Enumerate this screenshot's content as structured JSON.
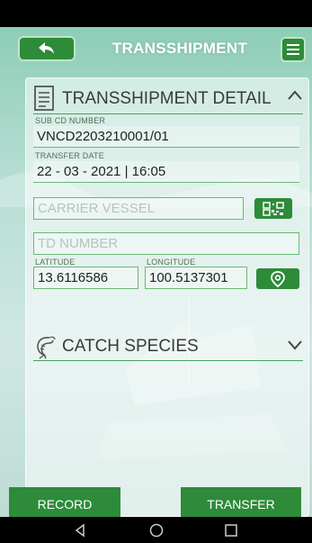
{
  "header": {
    "title": "TRANSSHIPMENT"
  },
  "details": {
    "section_title": "TRANSSHIPMENT DETAIL",
    "sub_cd_label": "SUB CD NUMBER",
    "sub_cd_value": "VNCD2203210001/01",
    "transfer_date_label": "TRANSFER DATE",
    "transfer_date_value": "22 - 03 - 2021 | 16:05",
    "carrier_vessel_placeholder": "CARRIER VESSEL",
    "td_number_placeholder": "TD NUMBER",
    "latitude_label": "LATITUDE",
    "latitude_value": "13.6116586",
    "longitude_label": "LONGITUDE",
    "longitude_value": "100.5137301"
  },
  "catch": {
    "section_title": "CATCH SPECIES"
  },
  "actions": {
    "record_label": "RECORD",
    "transfer_label": "TRANSFER"
  },
  "icons": {
    "back": "back-arrow-icon",
    "menu": "hamburger-menu-icon",
    "document": "document-icon",
    "qr": "qr-code-icon",
    "location": "location-pin-icon",
    "species": "shrimp-icon",
    "collapse": "chevron-up-icon",
    "expand": "chevron-down-icon"
  },
  "colors": {
    "primary": "#2e8b3a",
    "underline": "#4aa35a",
    "field_border": "#6cb876"
  }
}
